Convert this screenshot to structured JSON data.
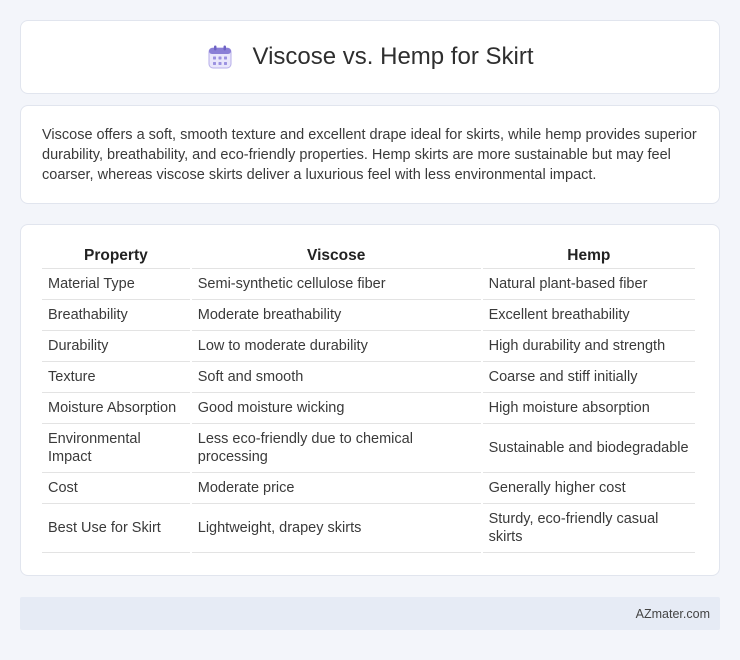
{
  "header": {
    "title": "Viscose vs. Hemp for Skirt",
    "icon": "calendar-icon",
    "accent": "#8a7fd6"
  },
  "summary": {
    "text": "Viscose offers a soft, smooth texture and excellent drape ideal for skirts, while hemp provides superior durability, breathability, and eco-friendly properties. Hemp skirts are more sustainable but may feel coarser, whereas viscose skirts deliver a luxurious feel with less environmental impact."
  },
  "table": {
    "headers": [
      "Property",
      "Viscose",
      "Hemp"
    ],
    "rows": [
      [
        "Material Type",
        "Semi-synthetic cellulose fiber",
        "Natural plant-based fiber"
      ],
      [
        "Breathability",
        "Moderate breathability",
        "Excellent breathability"
      ],
      [
        "Durability",
        "Low to moderate durability",
        "High durability and strength"
      ],
      [
        "Texture",
        "Soft and smooth",
        "Coarse and stiff initially"
      ],
      [
        "Moisture Absorption",
        "Good moisture wicking",
        "High moisture absorption"
      ],
      [
        "Environmental Impact",
        "Less eco-friendly due to chemical processing",
        "Sustainable and biodegradable"
      ],
      [
        "Cost",
        "Moderate price",
        "Generally higher cost"
      ],
      [
        "Best Use for Skirt",
        "Lightweight, drapey skirts",
        "Sturdy, eco-friendly casual skirts"
      ]
    ]
  },
  "footer": {
    "brand": "AZmater.com"
  }
}
